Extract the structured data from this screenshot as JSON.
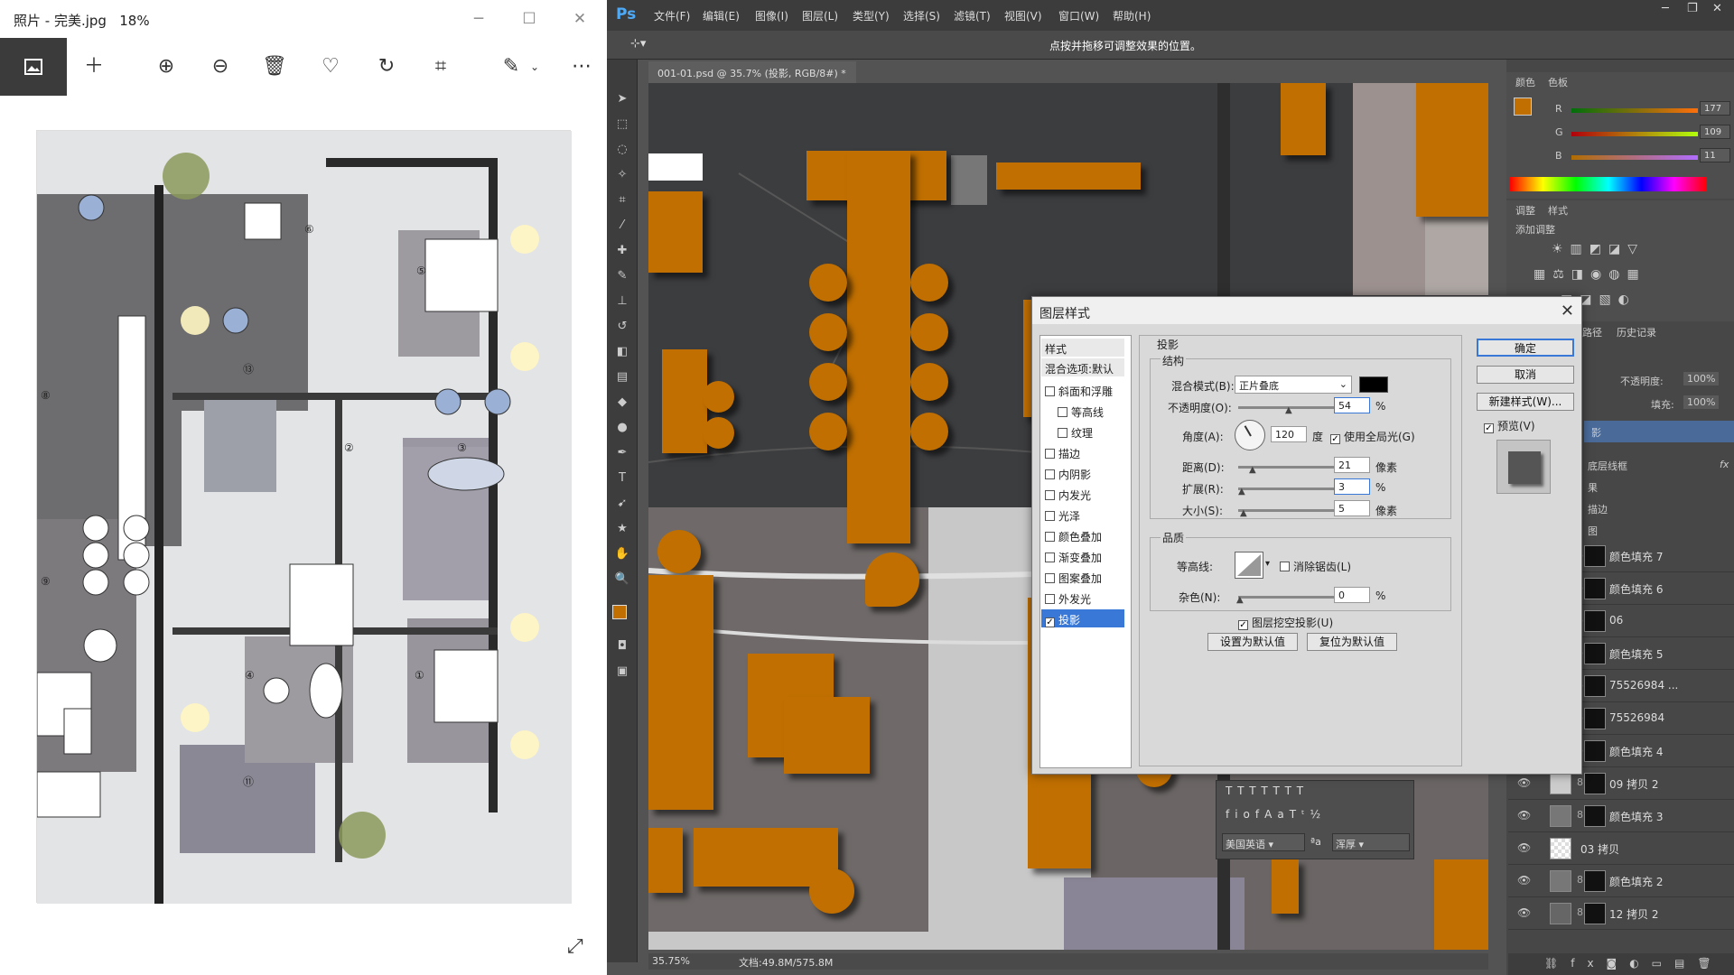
{
  "photos": {
    "title": "照片 - 完美.jpg",
    "zoom": "18%",
    "toolbar_icons": [
      "image-icon",
      "add-icon",
      "zoom-in-icon",
      "zoom-out-icon",
      "delete-icon",
      "heart-icon",
      "rotate-icon",
      "crop-icon",
      "edit-icon",
      "more-icon"
    ],
    "room_numbers": [
      "⑥",
      "⑤",
      "⑬",
      "⑧",
      "②",
      "③",
      "⑨",
      "④",
      "①",
      "⑪"
    ]
  },
  "ps": {
    "logo": "Ps",
    "menus": [
      "文件(F)",
      "编辑(E)",
      "图像(I)",
      "图层(L)",
      "类型(Y)",
      "选择(S)",
      "滤镜(T)",
      "视图(V)",
      "窗口(W)",
      "帮助(H)"
    ],
    "hint": "点按并拖移可调整效果的位置。",
    "doc_tab": "001-01.psd @ 35.7% (投影, RGB/8#) *",
    "status_zoom": "35.75%",
    "status_doc": "文档:49.8M/575.8M",
    "accent_color": "#c06f00",
    "color_panel": {
      "tabs": [
        "颜色",
        "色板"
      ],
      "r_label": "R",
      "r_value": "177",
      "g_label": "G",
      "g_value": "109",
      "b_label": "B",
      "b_value": "11"
    },
    "adjust_panel": {
      "tabs": [
        "调整",
        "样式"
      ],
      "add_label": "添加调整"
    },
    "char_panel": {
      "lang": "美国英语",
      "aa_label": "ªa",
      "aa_value": "浑厚"
    },
    "layers_panel": {
      "tabs": [
        "路径",
        "历史记录"
      ],
      "opacity_label": "不透明度:",
      "opacity_value": "100%",
      "fill_label": "填充:",
      "fill_value": "100%",
      "partial_rows": [
        "影",
        "底层线框",
        "果",
        "描边",
        "图"
      ],
      "rows": [
        "颜色填充 7",
        "颜色填充 6",
        "06",
        "颜色填充 5",
        "75526984 ...",
        "75526984",
        "颜色填充 4",
        "09 拷贝 2",
        "颜色填充 3",
        "03 拷贝",
        "颜色填充 2",
        "12 拷贝 2"
      ]
    }
  },
  "dialog": {
    "title": "图层样式",
    "styles_header": "样式",
    "blend_default": "混合选项:默认",
    "fx_items": [
      {
        "label": "斜面和浮雕",
        "checked": false
      },
      {
        "label": "等高线",
        "checked": false
      },
      {
        "label": "纹理",
        "checked": false
      },
      {
        "label": "描边",
        "checked": false
      },
      {
        "label": "内阴影",
        "checked": false
      },
      {
        "label": "内发光",
        "checked": false
      },
      {
        "label": "光泽",
        "checked": false
      },
      {
        "label": "颜色叠加",
        "checked": false
      },
      {
        "label": "渐变叠加",
        "checked": false
      },
      {
        "label": "图案叠加",
        "checked": false
      },
      {
        "label": "外发光",
        "checked": false
      },
      {
        "label": "投影",
        "checked": true
      }
    ],
    "section_title": "投影",
    "structure": "结构",
    "blend_mode_label": "混合模式(B):",
    "blend_mode_value": "正片叠底",
    "shadow_color": "#000000",
    "opacity_label": "不透明度(O):",
    "opacity_value": "54",
    "percent": "%",
    "angle_label": "角度(A):",
    "angle_value": "120",
    "degree": "度",
    "global_light": "使用全局光(G)",
    "distance_label": "距离(D):",
    "distance_value": "21",
    "pixels": "像素",
    "spread_label": "扩展(R):",
    "spread_value": "3",
    "size_label": "大小(S):",
    "size_value": "5",
    "quality": "品质",
    "contour_label": "等高线:",
    "antialias": "消除锯齿(L)",
    "noise_label": "杂色(N):",
    "noise_value": "0",
    "knockout": "图层挖空投影(U)",
    "set_default": "设置为默认值",
    "reset_default": "复位为默认值",
    "ok": "确定",
    "cancel": "取消",
    "new_style": "新建样式(W)...",
    "preview": "预览(V)"
  }
}
